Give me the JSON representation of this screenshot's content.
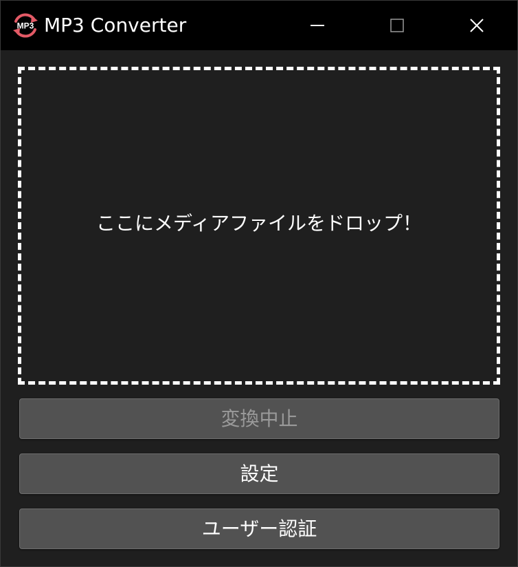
{
  "window": {
    "title": "MP3 Converter",
    "icon": "mp3-convert-icon",
    "icon_text": "MP3",
    "icon_color": "#e35a66"
  },
  "titlebar_controls": {
    "minimize_icon": "minimize-icon",
    "maximize_icon": "maximize-icon",
    "close_icon": "close-icon"
  },
  "drop_zone": {
    "text": "ここにメディアファイルをドロップ！"
  },
  "buttons": {
    "stop": {
      "label": "変換中止",
      "enabled": false
    },
    "settings": {
      "label": "設定",
      "enabled": true
    },
    "auth": {
      "label": "ユーザー認証",
      "enabled": true
    }
  },
  "colors": {
    "titlebar_bg": "#000000",
    "window_bg": "#1f1f1f",
    "button_bg": "#525252",
    "text": "#ffffff",
    "disabled_text": "#9a9a9a"
  }
}
